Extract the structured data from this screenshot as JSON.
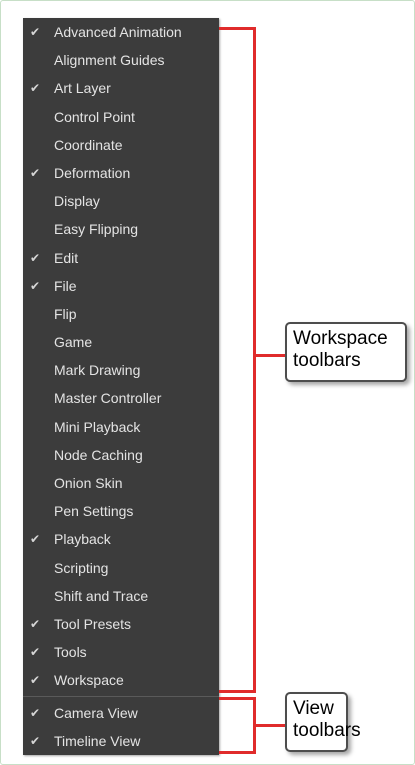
{
  "workspace_items": [
    {
      "label": "Advanced Animation",
      "checked": true
    },
    {
      "label": "Alignment Guides",
      "checked": false
    },
    {
      "label": "Art Layer",
      "checked": true
    },
    {
      "label": "Control Point",
      "checked": false
    },
    {
      "label": "Coordinate",
      "checked": false
    },
    {
      "label": "Deformation",
      "checked": true
    },
    {
      "label": "Display",
      "checked": false
    },
    {
      "label": "Easy Flipping",
      "checked": false
    },
    {
      "label": "Edit",
      "checked": true
    },
    {
      "label": "File",
      "checked": true
    },
    {
      "label": "Flip",
      "checked": false
    },
    {
      "label": "Game",
      "checked": false
    },
    {
      "label": "Mark Drawing",
      "checked": false
    },
    {
      "label": "Master Controller",
      "checked": false
    },
    {
      "label": "Mini Playback",
      "checked": false
    },
    {
      "label": "Node Caching",
      "checked": false
    },
    {
      "label": "Onion Skin",
      "checked": false
    },
    {
      "label": "Pen Settings",
      "checked": false
    },
    {
      "label": "Playback",
      "checked": true
    },
    {
      "label": "Scripting",
      "checked": false
    },
    {
      "label": "Shift and Trace",
      "checked": false
    },
    {
      "label": "Tool Presets",
      "checked": true
    },
    {
      "label": "Tools",
      "checked": true
    },
    {
      "label": "Workspace",
      "checked": true
    }
  ],
  "view_items": [
    {
      "label": "Camera View",
      "checked": true
    },
    {
      "label": "Timeline View",
      "checked": true
    }
  ],
  "check_glyph": "✔",
  "callouts": {
    "workspace_line1": "Workspace",
    "workspace_line2": "toolbars",
    "view_line1": "View",
    "view_line2": "toolbars"
  },
  "colors": {
    "menu_bg": "#3c3c3c",
    "menu_text": "#e4e4e4",
    "bracket": "#e02b2b"
  }
}
